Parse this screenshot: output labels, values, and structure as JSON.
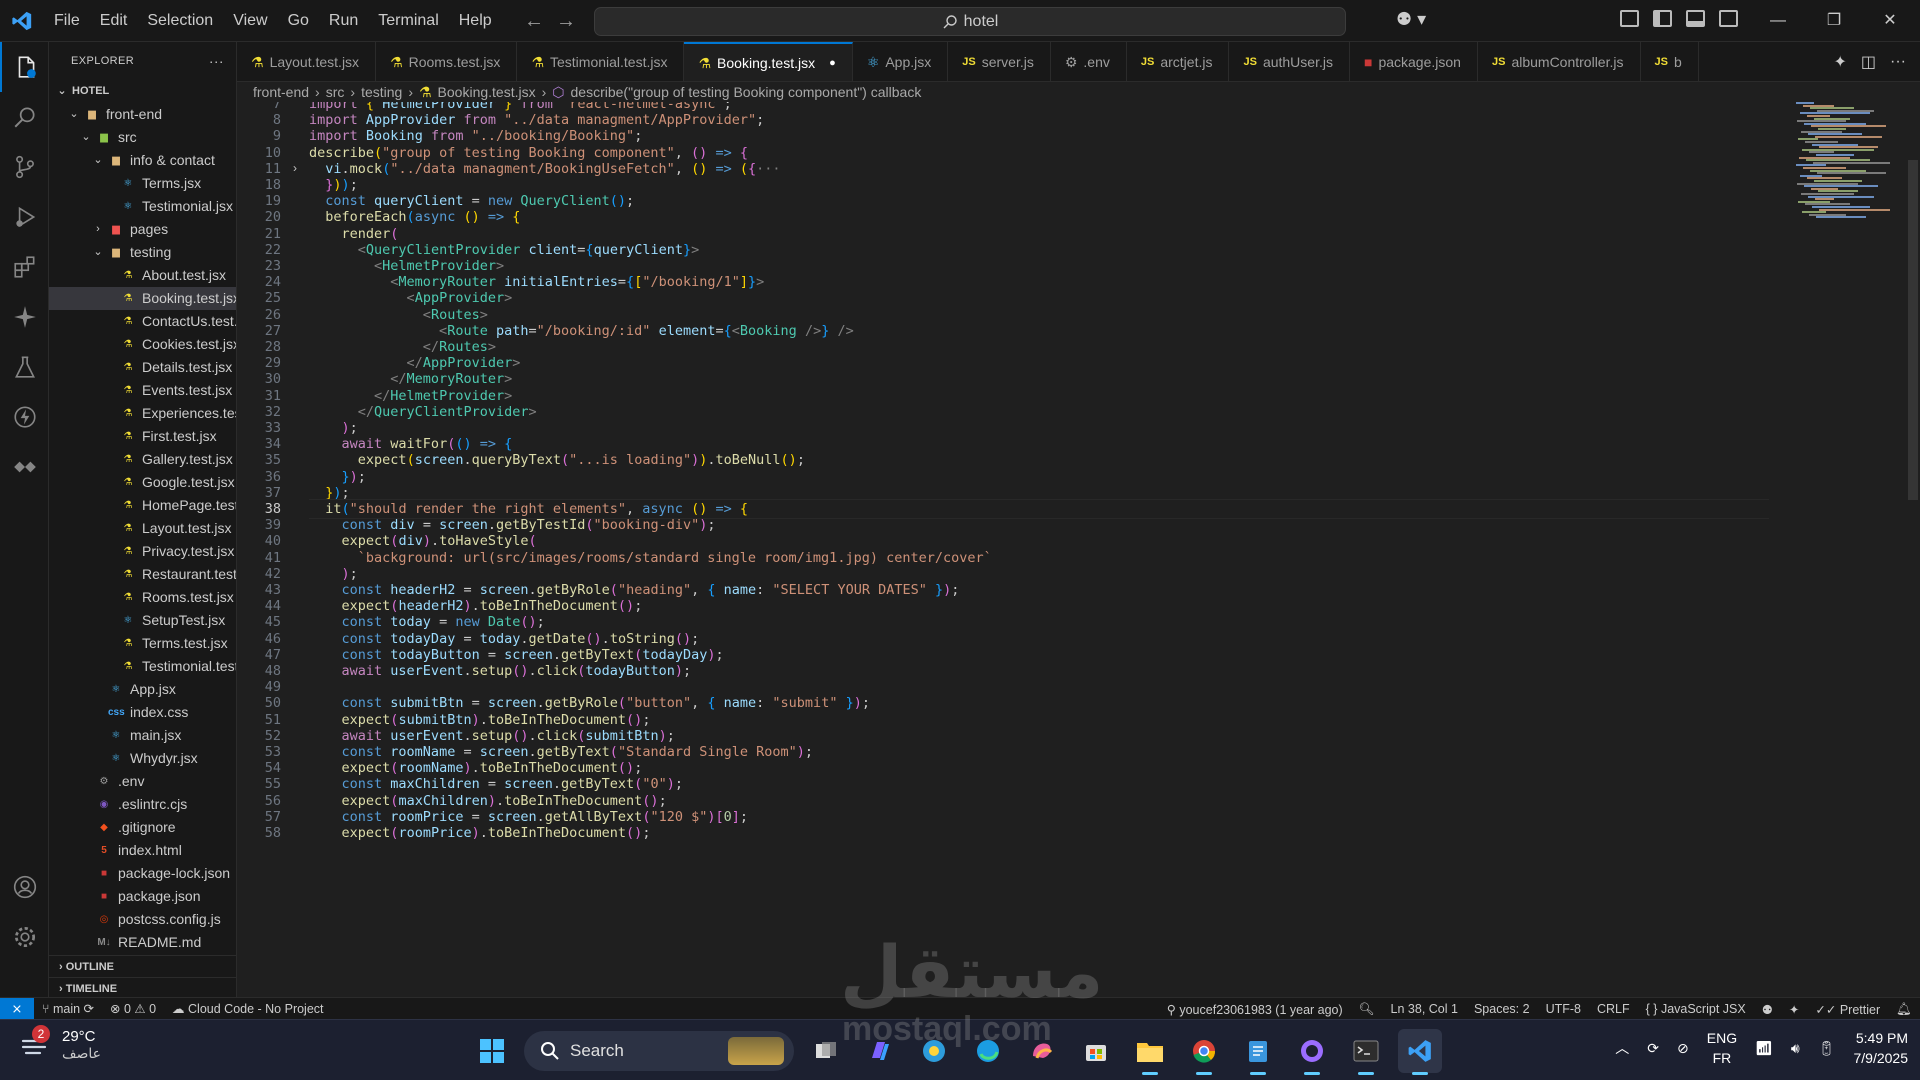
{
  "titlebar": {
    "menu": [
      "File",
      "Edit",
      "Selection",
      "View",
      "Go",
      "Run",
      "Terminal",
      "Help"
    ],
    "search": "hotel"
  },
  "explorer": {
    "title": "EXPLORER",
    "root": "HOTEL",
    "tree": [
      {
        "label": "front-end",
        "depth": 1,
        "kind": "folder",
        "open": true
      },
      {
        "label": "src",
        "depth": 2,
        "kind": "folder-src",
        "open": true
      },
      {
        "label": "info & contact",
        "depth": 3,
        "kind": "folder",
        "open": true
      },
      {
        "label": "Terms.jsx",
        "depth": 4,
        "kind": "react"
      },
      {
        "label": "Testimonial.jsx",
        "depth": 4,
        "kind": "react"
      },
      {
        "label": "pages",
        "depth": 3,
        "kind": "folder-pages",
        "open": false
      },
      {
        "label": "testing",
        "depth": 3,
        "kind": "folder",
        "open": true
      },
      {
        "label": "About.test.jsx",
        "depth": 4,
        "kind": "test"
      },
      {
        "label": "Booking.test.jsx",
        "depth": 4,
        "kind": "test",
        "selected": true
      },
      {
        "label": "ContactUs.test.j...",
        "depth": 4,
        "kind": "test"
      },
      {
        "label": "Cookies.test.jsx",
        "depth": 4,
        "kind": "test"
      },
      {
        "label": "Details.test.jsx",
        "depth": 4,
        "kind": "test"
      },
      {
        "label": "Events.test.jsx",
        "depth": 4,
        "kind": "test"
      },
      {
        "label": "Experiences.tes...",
        "depth": 4,
        "kind": "test"
      },
      {
        "label": "First.test.jsx",
        "depth": 4,
        "kind": "test"
      },
      {
        "label": "Gallery.test.jsx",
        "depth": 4,
        "kind": "test"
      },
      {
        "label": "Google.test.jsx",
        "depth": 4,
        "kind": "test"
      },
      {
        "label": "HomePage.test....",
        "depth": 4,
        "kind": "test"
      },
      {
        "label": "Layout.test.jsx",
        "depth": 4,
        "kind": "test"
      },
      {
        "label": "Privacy.test.jsx",
        "depth": 4,
        "kind": "test"
      },
      {
        "label": "Restaurant.test....",
        "depth": 4,
        "kind": "test"
      },
      {
        "label": "Rooms.test.jsx",
        "depth": 4,
        "kind": "test"
      },
      {
        "label": "SetupTest.jsx",
        "depth": 4,
        "kind": "react"
      },
      {
        "label": "Terms.test.jsx",
        "depth": 4,
        "kind": "test"
      },
      {
        "label": "Testimonial.test....",
        "depth": 4,
        "kind": "test"
      },
      {
        "label": "App.jsx",
        "depth": 3,
        "kind": "react"
      },
      {
        "label": "index.css",
        "depth": 3,
        "kind": "css"
      },
      {
        "label": "main.jsx",
        "depth": 3,
        "kind": "react"
      },
      {
        "label": "Whydyr.jsx",
        "depth": 3,
        "kind": "react"
      },
      {
        "label": ".env",
        "depth": 2,
        "kind": "gear"
      },
      {
        "label": ".eslintrc.cjs",
        "depth": 2,
        "kind": "eslint"
      },
      {
        "label": ".gitignore",
        "depth": 2,
        "kind": "git"
      },
      {
        "label": "index.html",
        "depth": 2,
        "kind": "html"
      },
      {
        "label": "package-lock.json",
        "depth": 2,
        "kind": "npm"
      },
      {
        "label": "package.json",
        "depth": 2,
        "kind": "npm"
      },
      {
        "label": "postcss.config.js",
        "depth": 2,
        "kind": "postcss"
      },
      {
        "label": "README.md",
        "depth": 2,
        "kind": "md"
      }
    ],
    "outline": "OUTLINE",
    "timeline": "TIMELINE"
  },
  "tabs": [
    {
      "label": "Layout.test.jsx",
      "icon": "test"
    },
    {
      "label": "Rooms.test.jsx",
      "icon": "test"
    },
    {
      "label": "Testimonial.test.jsx",
      "icon": "test"
    },
    {
      "label": "Booking.test.jsx",
      "icon": "test",
      "active": true,
      "dirty": true
    },
    {
      "label": "App.jsx",
      "icon": "react"
    },
    {
      "label": "server.js",
      "icon": "js"
    },
    {
      "label": ".env",
      "icon": "gear"
    },
    {
      "label": "arctjet.js",
      "icon": "js"
    },
    {
      "label": "authUser.js",
      "icon": "js"
    },
    {
      "label": "package.json",
      "icon": "npm"
    },
    {
      "label": "albumController.js",
      "icon": "js"
    },
    {
      "label": "b",
      "icon": "js"
    }
  ],
  "breadcrumb": [
    "front-end",
    "src",
    "testing",
    "Booking.test.jsx",
    "describe(\"group of testing Booking component\") callback"
  ],
  "editor": {
    "current_line": 38,
    "lines": [
      {
        "n": 7,
        "html": "<span class='kc'>import</span> <span class='br1'>{</span> <span class='vr'>HelmetProvider</span> <span class='br1'>}</span> <span class='kc'>from</span> <span class='st'>\"react-helmet-async\"</span>;"
      },
      {
        "n": 8,
        "html": "<span class='kc'>import</span> <span class='vr'>AppProvider</span> <span class='kc'>from</span> <span class='st'>\"../data managment/AppProvider\"</span>;"
      },
      {
        "n": 9,
        "html": "<span class='kc'>import</span> <span class='vr'>Booking</span> <span class='kc'>from</span> <span class='st'>\"../booking/Booking\"</span>;"
      },
      {
        "n": 10,
        "html": "<span class='fn'>describe</span><span class='br1'>(</span><span class='st'>\"group of testing Booking component\"</span>, <span class='br2'>()</span> <span class='kw'>=&gt;</span> <span class='br2'>{</span>"
      },
      {
        "n": 11,
        "fold": "&gt;",
        "html": "  <span class='vr'>vi</span>.<span class='fn'>mock</span><span class='br3'>(</span><span class='st'>\"../data managment/BookingUseFetch\"</span>, <span class='br1'>()</span> <span class='kw'>=&gt;</span> <span class='br1'>(</span><span class='br2'>{</span><span class='pt'>···</span>"
      },
      {
        "n": 18,
        "html": "  <span class='br2'>}</span><span class='br1'>)</span><span class='br3'>)</span>;"
      },
      {
        "n": 19,
        "html": "  <span class='kw'>const</span> <span class='vr'>queryClient</span> = <span class='kw'>new</span> <span class='cl2'>QueryClient</span><span class='br3'>()</span>;"
      },
      {
        "n": 20,
        "html": "  <span class='fn'>beforeEach</span><span class='br3'>(</span><span class='kw'>async</span> <span class='br1'>()</span> <span class='kw'>=&gt;</span> <span class='br1'>{</span>"
      },
      {
        "n": 21,
        "html": "    <span class='fn'>render</span><span class='br2'>(</span>"
      },
      {
        "n": 22,
        "html": "      <span class='pt'>&lt;</span><span class='tg'>QueryClientProvider</span> <span class='at'>client</span>=<span class='br3'>{</span><span class='vr'>queryClient</span><span class='br3'>}</span><span class='pt'>&gt;</span>"
      },
      {
        "n": 23,
        "html": "        <span class='pt'>&lt;</span><span class='tg'>HelmetProvider</span><span class='pt'>&gt;</span>"
      },
      {
        "n": 24,
        "html": "          <span class='pt'>&lt;</span><span class='tg'>MemoryRouter</span> <span class='at'>initialEntries</span>=<span class='br3'>{</span><span class='br1'>[</span><span class='st'>\"/booking/1\"</span><span class='br1'>]</span><span class='br3'>}</span><span class='pt'>&gt;</span>"
      },
      {
        "n": 25,
        "html": "            <span class='pt'>&lt;</span><span class='tg'>AppProvider</span><span class='pt'>&gt;</span>"
      },
      {
        "n": 26,
        "html": "              <span class='pt'>&lt;</span><span class='tg'>Routes</span><span class='pt'>&gt;</span>"
      },
      {
        "n": 27,
        "html": "                <span class='pt'>&lt;</span><span class='tg'>Route</span> <span class='at'>path</span>=<span class='st'>\"/booking/:id\"</span> <span class='at'>element</span>=<span class='br3'>{</span><span class='pt'>&lt;</span><span class='tg'>Booking</span> <span class='pt'>/&gt;</span><span class='br3'>}</span> <span class='pt'>/&gt;</span>"
      },
      {
        "n": 28,
        "html": "              <span class='pt'>&lt;/</span><span class='tg'>Routes</span><span class='pt'>&gt;</span>"
      },
      {
        "n": 29,
        "html": "            <span class='pt'>&lt;/</span><span class='tg'>AppProvider</span><span class='pt'>&gt;</span>"
      },
      {
        "n": 30,
        "html": "          <span class='pt'>&lt;/</span><span class='tg'>MemoryRouter</span><span class='pt'>&gt;</span>"
      },
      {
        "n": 31,
        "html": "        <span class='pt'>&lt;/</span><span class='tg'>HelmetProvider</span><span class='pt'>&gt;</span>"
      },
      {
        "n": 32,
        "html": "      <span class='pt'>&lt;/</span><span class='tg'>QueryClientProvider</span><span class='pt'>&gt;</span>"
      },
      {
        "n": 33,
        "html": "    <span class='br2'>)</span>;"
      },
      {
        "n": 34,
        "html": "    <span class='kc'>await</span> <span class='fn'>waitFor</span><span class='br2'>(</span><span class='br3'>()</span> <span class='kw'>=&gt;</span> <span class='br3'>{</span>"
      },
      {
        "n": 35,
        "html": "      <span class='fn'>expect</span><span class='br1'>(</span><span class='vr'>screen</span>.<span class='fn'>queryByText</span><span class='br2'>(</span><span class='st'>\"...is loading\"</span><span class='br2'>)</span><span class='br1'>)</span>.<span class='fn'>toBeNull</span><span class='br1'>()</span>;"
      },
      {
        "n": 36,
        "html": "    <span class='br3'>}</span><span class='br2'>)</span>;"
      },
      {
        "n": 37,
        "html": "  <span class='br1'>}</span><span class='br3'>)</span>;"
      },
      {
        "n": 38,
        "html": "  <span class='fn'>it</span><span class='br3'>(</span><span class='st'>\"should render the right elements\"</span>, <span class='kw'>async</span> <span class='br1'>()</span> <span class='kw'>=&gt;</span> <span class='br1'>{</span>"
      },
      {
        "n": 39,
        "html": "    <span class='kw'>const</span> <span class='vr'>div</span> = <span class='vr'>screen</span>.<span class='fn'>getByTestId</span><span class='br2'>(</span><span class='st'>\"booking-div\"</span><span class='br2'>)</span>;"
      },
      {
        "n": 40,
        "html": "    <span class='fn'>expect</span><span class='br2'>(</span><span class='vr'>div</span><span class='br2'>)</span>.<span class='fn'>toHaveStyle</span><span class='br2'>(</span>"
      },
      {
        "n": 41,
        "html": "      <span class='st'>`background: url(src/images/rooms/standard single room/img1.jpg) center/cover`</span>"
      },
      {
        "n": 42,
        "html": "    <span class='br2'>)</span>;"
      },
      {
        "n": 43,
        "html": "    <span class='kw'>const</span> <span class='vr'>headerH2</span> = <span class='vr'>screen</span>.<span class='fn'>getByRole</span><span class='br2'>(</span><span class='st'>\"heading\"</span>, <span class='br3'>{</span> <span class='vr'>name</span>: <span class='st'>\"SELECT YOUR DATES\"</span> <span class='br3'>}</span><span class='br2'>)</span>;"
      },
      {
        "n": 44,
        "html": "    <span class='fn'>expect</span><span class='br2'>(</span><span class='vr'>headerH2</span><span class='br2'>)</span>.<span class='fn'>toBeInTheDocument</span><span class='br2'>()</span>;"
      },
      {
        "n": 45,
        "html": "    <span class='kw'>const</span> <span class='vr'>today</span> = <span class='kw'>new</span> <span class='cl2'>Date</span><span class='br2'>()</span>;"
      },
      {
        "n": 46,
        "html": "    <span class='kw'>const</span> <span class='vr'>todayDay</span> = <span class='vr'>today</span>.<span class='fn'>getDate</span><span class='br2'>()</span>.<span class='fn'>toString</span><span class='br2'>()</span>;"
      },
      {
        "n": 47,
        "html": "    <span class='kw'>const</span> <span class='vr'>todayButton</span> = <span class='vr'>screen</span>.<span class='fn'>getByText</span><span class='br2'>(</span><span class='vr'>todayDay</span><span class='br2'>)</span>;"
      },
      {
        "n": 48,
        "html": "    <span class='kc'>await</span> <span class='vr'>userEvent</span>.<span class='fn'>setup</span><span class='br2'>()</span>.<span class='fn'>click</span><span class='br2'>(</span><span class='vr'>todayButton</span><span class='br2'>)</span>;"
      },
      {
        "n": 49,
        "html": ""
      },
      {
        "n": 50,
        "html": "    <span class='kw'>const</span> <span class='vr'>submitBtn</span> = <span class='vr'>screen</span>.<span class='fn'>getByRole</span><span class='br2'>(</span><span class='st'>\"button\"</span>, <span class='br3'>{</span> <span class='vr'>name</span>: <span class='st'>\"submit\"</span> <span class='br3'>}</span><span class='br2'>)</span>;"
      },
      {
        "n": 51,
        "html": "    <span class='fn'>expect</span><span class='br2'>(</span><span class='vr'>submitBtn</span><span class='br2'>)</span>.<span class='fn'>toBeInTheDocument</span><span class='br2'>()</span>;"
      },
      {
        "n": 52,
        "html": "    <span class='kc'>await</span> <span class='vr'>userEvent</span>.<span class='fn'>setup</span><span class='br2'>()</span>.<span class='fn'>click</span><span class='br2'>(</span><span class='vr'>submitBtn</span><span class='br2'>)</span>;"
      },
      {
        "n": 53,
        "html": "    <span class='kw'>const</span> <span class='vr'>roomName</span> = <span class='vr'>screen</span>.<span class='fn'>getByText</span><span class='br2'>(</span><span class='st'>\"Standard Single Room\"</span><span class='br2'>)</span>;"
      },
      {
        "n": 54,
        "html": "    <span class='fn'>expect</span><span class='br2'>(</span><span class='vr'>roomName</span><span class='br2'>)</span>.<span class='fn'>toBeInTheDocument</span><span class='br2'>()</span>;"
      },
      {
        "n": 55,
        "html": "    <span class='kw'>const</span> <span class='vr'>maxChildren</span> = <span class='vr'>screen</span>.<span class='fn'>getByText</span><span class='br2'>(</span><span class='st'>\"0\"</span><span class='br2'>)</span>;"
      },
      {
        "n": 56,
        "html": "    <span class='fn'>expect</span><span class='br2'>(</span><span class='vr'>maxChildren</span><span class='br2'>)</span>.<span class='fn'>toBeInTheDocument</span><span class='br2'>()</span>;"
      },
      {
        "n": 57,
        "html": "    <span class='kw'>const</span> <span class='vr'>roomPrice</span> = <span class='vr'>screen</span>.<span class='fn'>getAllByText</span><span class='br2'>(</span><span class='st'>\"120 $\"</span><span class='br2'>)</span><span class='br2'>[</span><span class='num'>0</span><span class='br2'>]</span>;"
      },
      {
        "n": 58,
        "html": "    <span class='fn'>expect</span><span class='br2'>(</span><span class='vr'>roomPrice</span><span class='br2'>)</span>.<span class='fn'>toBeInTheDocument</span><span class='br2'>()</span>;"
      }
    ]
  },
  "status": {
    "branch": "main",
    "problems_errors": "0",
    "problems_warnings": "0",
    "cloud": "Cloud Code - No Project",
    "blame": "youcef23061983 (1 year ago)",
    "position": "Ln 38, Col 1",
    "spaces": "Spaces: 2",
    "encoding": "UTF-8",
    "eol": "CRLF",
    "language": "JavaScript JSX",
    "prettier": "Prettier"
  },
  "taskbar": {
    "weather_temp": "29°C",
    "weather_desc": "عاصف",
    "weather_badge": "2",
    "search": "Search",
    "lang": "ENG",
    "layout": "FR",
    "time": "5:49 PM",
    "date": "7/9/2025"
  },
  "colors": {
    "accent": "#0078d4",
    "bg": "#1f1f1f",
    "chrome": "#181818"
  }
}
